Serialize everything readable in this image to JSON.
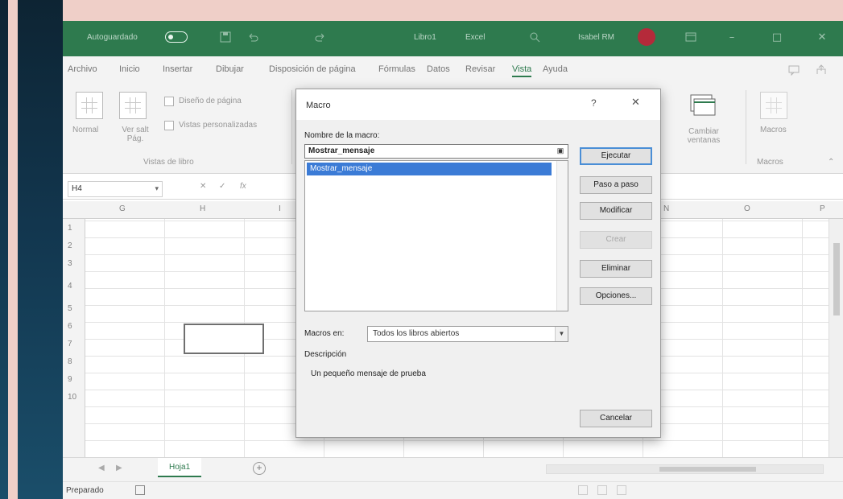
{
  "titlebar": {
    "autosave": "Autoguardado",
    "book": "Libro1",
    "saved": "Excel",
    "user": "Isabel RM"
  },
  "menu": {
    "items": [
      "Archivo",
      "Inicio",
      "Insertar",
      "Dibujar",
      "Disposición de página",
      "Fórmulas",
      "Datos",
      "Revisar",
      "Vista",
      "Ayuda"
    ],
    "active": "Vista"
  },
  "ribbon": {
    "normal": "Normal",
    "page_break": "Ver salt Pág.",
    "page_layout": "Diseño de página",
    "custom_views": "Vistas personalizadas",
    "group_label": "Vistas de libro",
    "switch_windows": "Cambiar ventanas",
    "macros": "Macros",
    "macros_group": "Macros"
  },
  "formula_bar": {
    "name_box": "H4"
  },
  "grid": {
    "columns": [
      "G",
      "H",
      "I",
      "N",
      "O",
      "P"
    ],
    "rows": [
      "1",
      "2",
      "3",
      "4",
      "5",
      "6",
      "7",
      "8",
      "9",
      "10"
    ]
  },
  "sheets": {
    "tabs": [
      "Hoja1"
    ]
  },
  "status": {
    "text": "Preparado"
  },
  "dialog": {
    "title": "Macro",
    "help": "?",
    "close": "✕",
    "name_label": "Nombre de la macro:",
    "name_value": "Mostrar_mensaje",
    "list_items": [
      "Mostrar_mensaje"
    ],
    "buttons": {
      "run": "Ejecutar",
      "step_into": "Paso a paso",
      "edit": "Modificar",
      "create": "Crear",
      "delete": "Eliminar",
      "options": "Opciones...",
      "cancel": "Cancelar"
    },
    "macros_in_label": "Macros en:",
    "macros_in_value": "Todos los libros abiertos",
    "description_label": "Descripción",
    "description_text": "Un pequeño mensaje de prueba"
  },
  "colors": {
    "excel_green": "#2e7a4e",
    "selection_blue": "#3b7bd6",
    "avatar": "#b52a3a"
  }
}
